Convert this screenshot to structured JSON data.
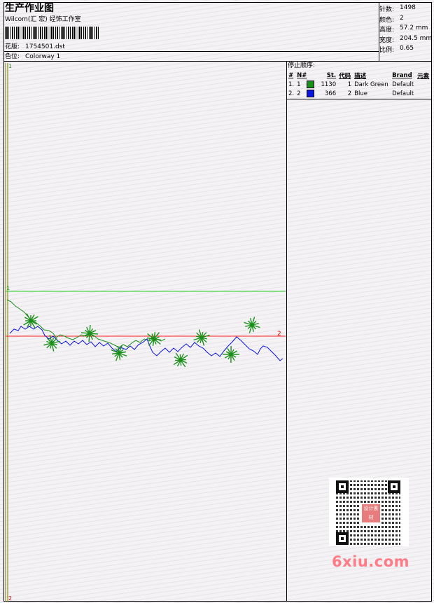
{
  "header": {
    "title": "生产作业图",
    "studio": "Wilcom(汇 宏) 经饰工作室",
    "design_label": "花版:",
    "design_file": "1754501.dst",
    "colorway_label": "色位:",
    "colorway": "Colorway 1"
  },
  "stats": {
    "stitches_label": "针数:",
    "stitches": "1498",
    "colors_label": "颜色:",
    "colors": "2",
    "height_label": "高度:",
    "height": "57.2 mm",
    "width_label": "宽度:",
    "width": "204.5 mm",
    "scale_label": "比例:",
    "scale": "0.65"
  },
  "stop_sequence": {
    "title": "停止顺序:",
    "columns": [
      "#",
      "N#",
      "St.",
      "代码",
      "描述",
      "Brand",
      "元素"
    ],
    "rows": [
      {
        "index": "1.",
        "n": "1",
        "color": "#1a8f1a",
        "stitches": "1130",
        "code": "1",
        "description": "Dark Green",
        "brand": "Default"
      },
      {
        "index": "2.",
        "n": "2",
        "color": "#0a14e0",
        "stitches": "366",
        "code": "2",
        "description": "Blue",
        "brand": "Default"
      }
    ]
  },
  "canvas": {
    "marker_top": "1",
    "marker_mid": "1",
    "marker_right": "2",
    "marker_bottom": "2",
    "green": "#1a8f1a",
    "blue": "#0a14e0",
    "guide_green": "#22cc22",
    "guide_red": "#ff1a1a",
    "axis": "#7a7a00"
  },
  "watermark": {
    "site": "6xiu.com",
    "seal": "设计素材"
  }
}
